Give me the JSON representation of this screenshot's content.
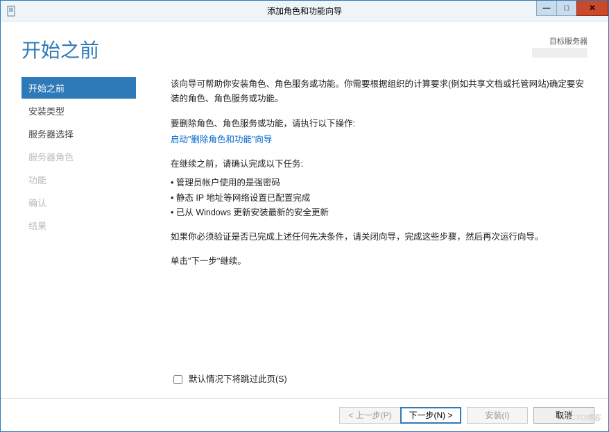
{
  "window": {
    "title": "添加角色和功能向导"
  },
  "header": {
    "page_title": "开始之前",
    "target_label": "目标服务器",
    "target_value": " "
  },
  "sidebar": {
    "steps": [
      {
        "label": "开始之前",
        "state": "active"
      },
      {
        "label": "安装类型",
        "state": "enabled"
      },
      {
        "label": "服务器选择",
        "state": "enabled"
      },
      {
        "label": "服务器角色",
        "state": "disabled"
      },
      {
        "label": "功能",
        "state": "disabled"
      },
      {
        "label": "确认",
        "state": "disabled"
      },
      {
        "label": "结果",
        "state": "disabled"
      }
    ]
  },
  "content": {
    "intro": "该向导可帮助你安装角色、角色服务或功能。你需要根据组织的计算要求(例如共享文档或托管网站)确定要安装的角色、角色服务或功能。",
    "remove_prompt": "要删除角色、角色服务或功能，请执行以下操作:",
    "remove_link": "启动\"删除角色和功能\"向导",
    "confirm_prompt": "在继续之前，请确认完成以下任务:",
    "bullets": [
      "管理员帐户使用的是强密码",
      "静态 IP 地址等网络设置已配置完成",
      "已从 Windows 更新安装最新的安全更新"
    ],
    "verify_note": "如果你必须验证是否已完成上述任何先决条件，请关闭向导，完成这些步骤，然后再次运行向导。",
    "continue_note": "单击\"下一步\"继续。",
    "skip_label": "默认情况下将跳过此页(S)"
  },
  "footer": {
    "prev": "< 上一步(P)",
    "next": "下一步(N) >",
    "install": "安装(I)",
    "cancel": "取消"
  },
  "watermark": "51CTO博客"
}
